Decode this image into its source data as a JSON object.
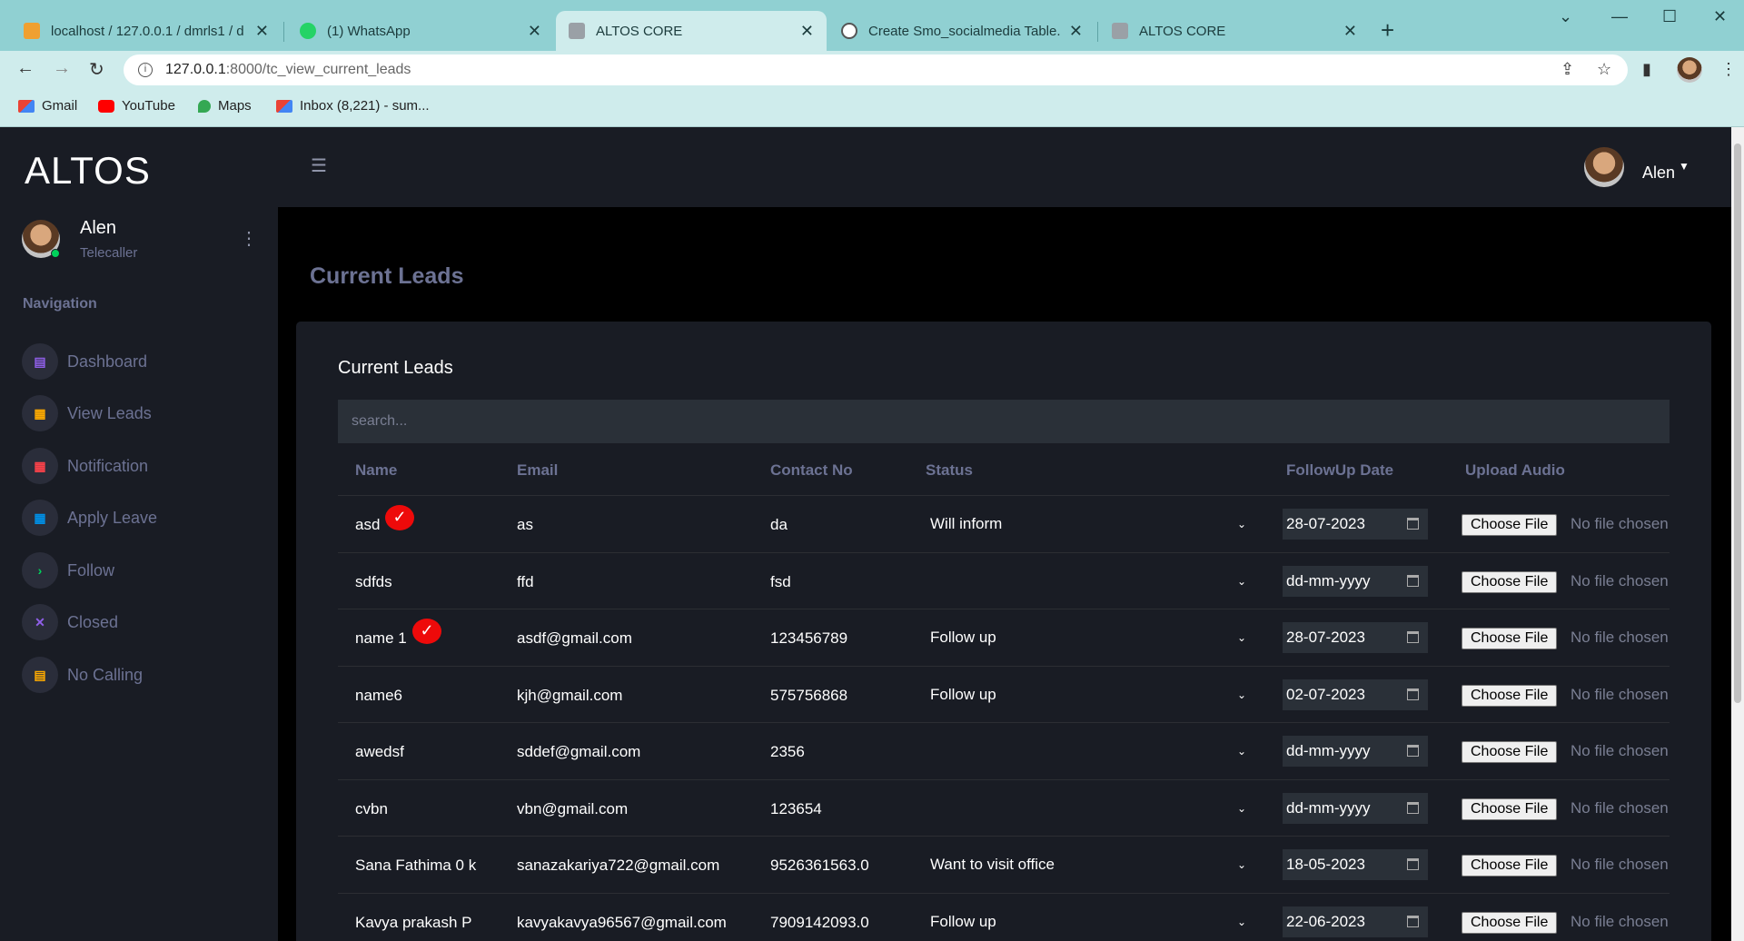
{
  "browser": {
    "tabs": [
      {
        "title": "localhost / 127.0.0.1 / dmrls1 / d",
        "icon": "phpmyadmin-icon"
      },
      {
        "title": "(1) WhatsApp",
        "icon": "whatsapp-icon"
      },
      {
        "title": "ALTOS CORE",
        "icon": "page-icon"
      },
      {
        "title": "Create Smo_socialmedia Table.",
        "icon": "chatgpt-icon"
      },
      {
        "title": "ALTOS CORE",
        "icon": "page-icon"
      }
    ],
    "url_host": "127.0.0.1",
    "url_path": ":8000/tc_view_current_leads",
    "bookmarks": [
      {
        "label": "Gmail",
        "icon": "gmail-icon"
      },
      {
        "label": "YouTube",
        "icon": "youtube-icon"
      },
      {
        "label": "Maps",
        "icon": "maps-icon"
      },
      {
        "label": "Inbox (8,221) - sum...",
        "icon": "gmail-icon"
      }
    ]
  },
  "sidebar": {
    "brand": "ALTOS",
    "profile": {
      "name": "Alen",
      "role": "Telecaller"
    },
    "nav_title": "Navigation",
    "items": [
      {
        "label": "Dashboard",
        "icon": "dashboard-icon",
        "color": "#8f5fe8"
      },
      {
        "label": "View Leads",
        "icon": "grid-icon",
        "color": "#ffab00"
      },
      {
        "label": "Notification",
        "icon": "grid-icon",
        "color": "#fc424a"
      },
      {
        "label": "Apply Leave",
        "icon": "grid-icon",
        "color": "#0090e7"
      },
      {
        "label": "Follow",
        "icon": "chevron-right-icon",
        "color": "#00d25b"
      },
      {
        "label": "Closed",
        "icon": "close-icon",
        "color": "#8f5fe8"
      },
      {
        "label": "No Calling",
        "icon": "document-icon",
        "color": "#ffab00"
      }
    ]
  },
  "topnav": {
    "user": "Alen"
  },
  "page": {
    "title": "Current Leads"
  },
  "card": {
    "title": "Current Leads",
    "search_placeholder": "search...",
    "columns": [
      "Name",
      "Email",
      "Contact No",
      "Status",
      "FollowUp Date",
      "Upload Audio"
    ],
    "choose_file_label": "Choose File",
    "no_file_label": "No file chosen",
    "rows": [
      {
        "name": "asd",
        "email": "as",
        "contact": "da",
        "status": "Will inform",
        "date": "28-07-2023",
        "checked": true
      },
      {
        "name": "sdfds",
        "email": "ffd",
        "contact": "fsd",
        "status": "",
        "date": "dd-mm-yyyy",
        "checked": false
      },
      {
        "name": "name 1",
        "email": "asdf@gmail.com",
        "contact": "123456789",
        "status": "Follow up",
        "date": "28-07-2023",
        "checked": true
      },
      {
        "name": "name6",
        "email": "kjh@gmail.com",
        "contact": "575756868",
        "status": "Follow up",
        "date": "02-07-2023",
        "checked": false
      },
      {
        "name": "awedsf",
        "email": "sddef@gmail.com",
        "contact": "2356",
        "status": "",
        "date": "dd-mm-yyyy",
        "checked": false
      },
      {
        "name": "cvbn",
        "email": "vbn@gmail.com",
        "contact": "123654",
        "status": "",
        "date": "dd-mm-yyyy",
        "checked": false
      },
      {
        "name": "Sana Fathima 0 k",
        "email": "sanazakariya722@gmail.com",
        "contact": "9526361563.0",
        "status": "Want to visit office",
        "date": "18-05-2023",
        "checked": false
      },
      {
        "name": "Kavya prakash P",
        "email": "kavyakavya96567@gmail.com",
        "contact": "7909142093.0",
        "status": "Follow up",
        "date": "22-06-2023",
        "checked": false
      }
    ]
  }
}
